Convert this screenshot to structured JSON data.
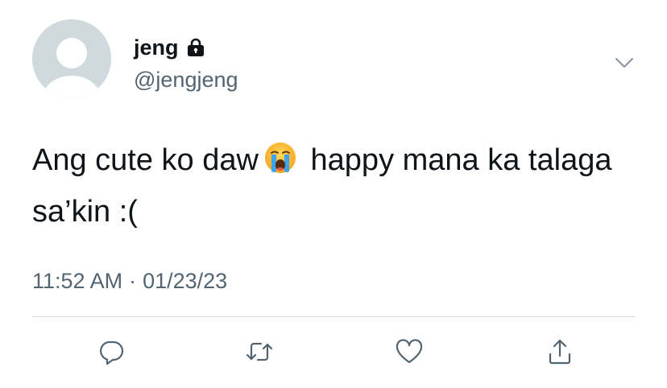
{
  "author": {
    "display_name": "jeng",
    "handle": "@jengjeng",
    "protected_icon": "lock-icon",
    "avatar_icon": "default-avatar-icon"
  },
  "tweet": {
    "text_part1": "Ang cute ko daw",
    "emoji": "loudly-crying-face-emoji",
    "text_part2": "happy mana ka talaga sa’kin :("
  },
  "meta": {
    "time": "11:52 AM",
    "separator": "·",
    "date": "01/23/23"
  },
  "actions": {
    "reply_icon": "reply-icon",
    "retweet_icon": "retweet-icon",
    "like_icon": "heart-icon",
    "share_icon": "share-icon"
  },
  "menu": {
    "more_icon": "chevron-down-icon"
  },
  "colors": {
    "text_primary": "#0f1419",
    "text_secondary": "#536471",
    "avatar_bg": "#cfd9de",
    "icon": "#536471"
  }
}
